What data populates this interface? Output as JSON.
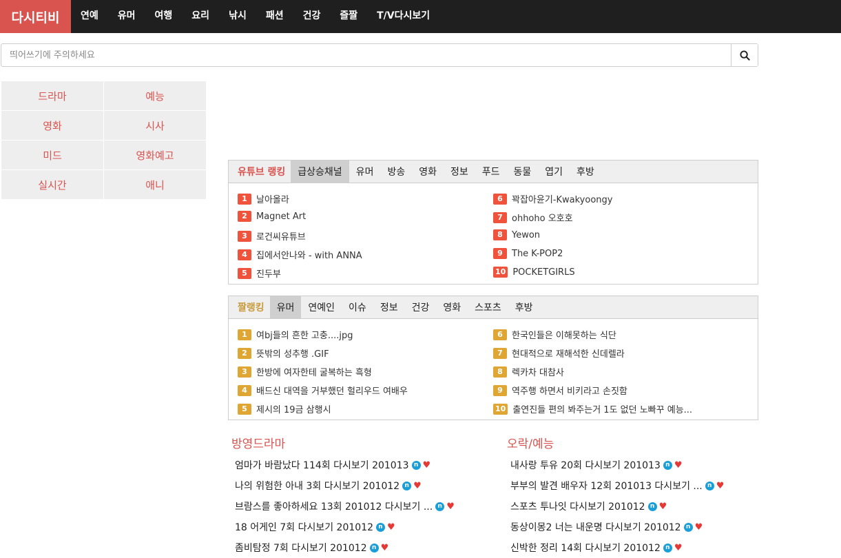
{
  "header": {
    "logo": "다시티비",
    "nav": [
      "연예",
      "유머",
      "여행",
      "요리",
      "낚시",
      "패션",
      "건강",
      "즐짤",
      "T/V다시보기"
    ]
  },
  "search": {
    "placeholder": "띄어쓰기에 주의하세요",
    "icon": "search-icon"
  },
  "categories": [
    "드라마",
    "예능",
    "영화",
    "시사",
    "미드",
    "영화예고",
    "실시간",
    "애니"
  ],
  "youtube_ranking": {
    "title": "유튜브 랭킹",
    "tabs": [
      "급상승채널",
      "유머",
      "방송",
      "영화",
      "정보",
      "푸드",
      "동물",
      "엽기",
      "후방"
    ],
    "active_tab": "급상승채널",
    "badge_color": "#f0533b",
    "items": [
      {
        "num": "1",
        "text": "날아올라"
      },
      {
        "num": "2",
        "text": "Magnet Art"
      },
      {
        "num": "3",
        "text": "로건씨유튜브"
      },
      {
        "num": "4",
        "text": "집에서안나와 - with ANNA"
      },
      {
        "num": "5",
        "text": "진두부"
      },
      {
        "num": "6",
        "text": "꽉잡아윤기-Kwakyoongy"
      },
      {
        "num": "7",
        "text": "ohhoho 오호호"
      },
      {
        "num": "8",
        "text": "Yewon"
      },
      {
        "num": "9",
        "text": "The K-POP2"
      },
      {
        "num": "10",
        "text": "POCKETGIRLS"
      }
    ]
  },
  "short_ranking": {
    "title": "짤랭킹",
    "tabs": [
      "유머",
      "연예인",
      "이슈",
      "정보",
      "건강",
      "영화",
      "스포츠",
      "후방"
    ],
    "active_tab": "유머",
    "badge_color": "#dfa634",
    "items": [
      {
        "num": "1",
        "text": "여bj들의 흔한 고충....jpg"
      },
      {
        "num": "2",
        "text": "뜻밖의 성추행 .GIF"
      },
      {
        "num": "3",
        "text": "한방에 여자한테 굴복하는 흑형"
      },
      {
        "num": "4",
        "text": "배드신 대역을 거부했던 헐리우드 여배우"
      },
      {
        "num": "5",
        "text": "제시의 19금 삼행시"
      },
      {
        "num": "6",
        "text": "한국인들은 이해못하는 식단"
      },
      {
        "num": "7",
        "text": "현대적으로 재해석한 신데렐라"
      },
      {
        "num": "8",
        "text": "렉카차 대참사"
      },
      {
        "num": "9",
        "text": "역주행 하면서 비키라고 손짓함"
      },
      {
        "num": "10",
        "text": "출연진들 편의 봐주는거 1도 없던 노빠꾸 예능..."
      }
    ]
  },
  "drama": {
    "title": "방영드라마",
    "items": [
      "엄마가 바람났다 114회 다시보기 201013",
      "나의 위험한 아내 3회 다시보기 201012",
      "브람스를 좋아하세요 13회 201012 다시보기 ...",
      "18 어게인 7회 다시보기 201012",
      "좀비탐정 7회 다시보기 201012"
    ]
  },
  "variety": {
    "title": "오락/예능",
    "items": [
      "내사랑 투유 20회 다시보기 201013",
      "부부의 발견 배우자 12회 201013 다시보기 ...",
      "스포츠 투나잇 다시보기 201012",
      "동상이몽2 너는 내운명 다시보기 201012",
      "신박한 정리 14회 다시보기 201012"
    ]
  },
  "badges": {
    "new": "n",
    "heart": "♥"
  },
  "colors": {
    "accent": "#d9534f",
    "nav_bg": "#1f1f1f",
    "new_badge": "#1a9ed8"
  }
}
